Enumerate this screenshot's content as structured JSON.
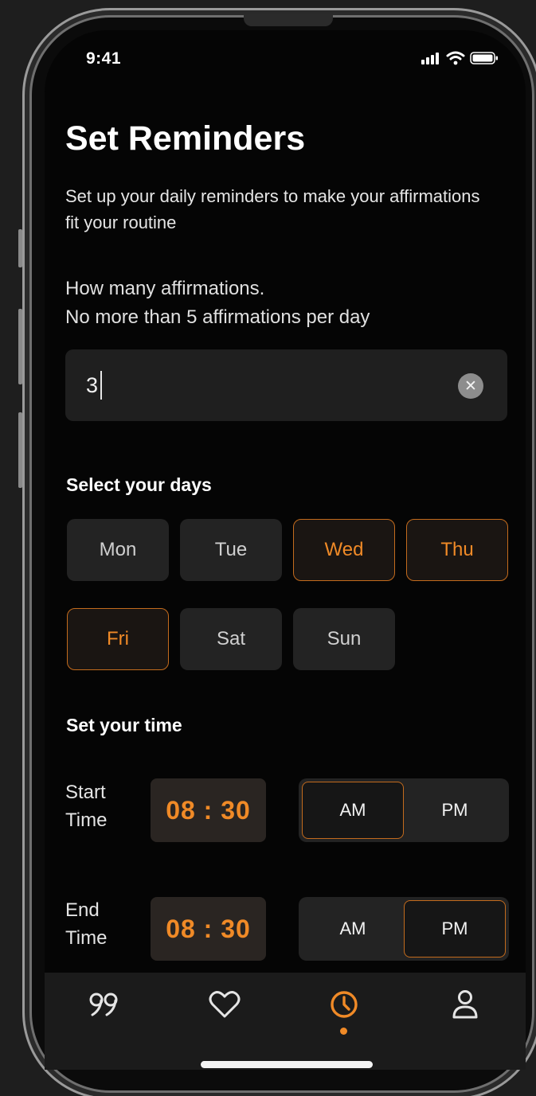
{
  "status": {
    "time": "9:41"
  },
  "header": {
    "title": "Set Reminders",
    "subtitle": "Set up your daily reminders to make your affirmations fit your routine"
  },
  "affirmations": {
    "question_line1": "How many affirmations.",
    "question_line2": "No more than 5 affirmations per day",
    "value": "3"
  },
  "days": {
    "label": "Select your days",
    "items": [
      {
        "label": "Mon",
        "selected": false
      },
      {
        "label": "Tue",
        "selected": false
      },
      {
        "label": "Wed",
        "selected": true
      },
      {
        "label": "Thu",
        "selected": true
      },
      {
        "label": "Fri",
        "selected": true
      },
      {
        "label": "Sat",
        "selected": false
      },
      {
        "label": "Sun",
        "selected": false
      }
    ]
  },
  "time": {
    "label": "Set your time",
    "start": {
      "label_line1": "Start",
      "label_line2": "Time",
      "value": "08 : 30",
      "am": "AM",
      "pm": "PM",
      "period": "AM"
    },
    "end": {
      "label_line1": "End",
      "label_line2": "Time",
      "value": "08 : 30",
      "am": "AM",
      "pm": "PM",
      "period": "PM"
    }
  },
  "tabs": [
    {
      "icon": "quote-icon",
      "active": false
    },
    {
      "icon": "heart-icon",
      "active": false
    },
    {
      "icon": "clock-icon",
      "active": true
    },
    {
      "icon": "profile-icon",
      "active": false
    }
  ],
  "colors": {
    "accent": "#f08a27",
    "accent_border": "#c36b1d",
    "background": "#050505",
    "surface": "#232323"
  }
}
